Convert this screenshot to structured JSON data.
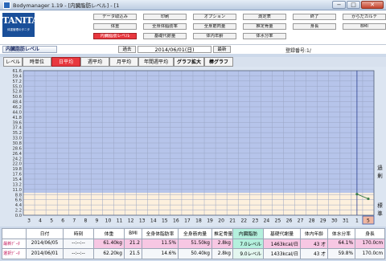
{
  "window": {
    "title": "Bodymanager 1.19 - [内臓脂肪レベル] - [1",
    "minimize": "−",
    "maximize": "□",
    "close": "✕"
  },
  "logo": {
    "text": "TANITA",
    "sub": "体重管理のタニタ"
  },
  "menu": {
    "row1": [
      "データ取込み",
      "印刷",
      "オプション",
      "測定表",
      "終了",
      "からだカルテ"
    ],
    "row2": [
      "体重",
      "全身体脂肪率",
      "全身筋肉量",
      "推定骨量",
      "身長",
      "BMI"
    ],
    "row3": [
      "内臓脂肪レベル",
      "基礎代謝量",
      "体内年齢",
      "体水分率"
    ],
    "active": "内臓脂肪レベル"
  },
  "section_title": "内臓脂肪レベル",
  "nav": {
    "prev": "過去",
    "date": "2014/06/01(日)",
    "next": "最新"
  },
  "registration": {
    "label": "登録番号:",
    "value": "1/"
  },
  "tabs": [
    "レベル",
    "時単位",
    "日平均",
    "週平均",
    "月平均",
    "年間週平均",
    "グラフ拡大",
    "棒グラフ"
  ],
  "active_tab": "日平均",
  "chart_data": {
    "type": "line",
    "ylim": [
      0,
      61.6
    ],
    "yticks": [
      "61.6",
      "59.4",
      "57.2",
      "55.0",
      "52.8",
      "50.6",
      "48.4",
      "46.2",
      "44.0",
      "41.8",
      "39.6",
      "37.4",
      "35.2",
      "33.0",
      "30.8",
      "28.6",
      "26.4",
      "24.2",
      "22.0",
      "19.8",
      "17.6",
      "15.4",
      "13.2",
      "11.0",
      "8.8",
      "6.6",
      "4.4",
      "2.2",
      "0.0"
    ],
    "x": [
      "3",
      "4",
      "5",
      "6",
      "7",
      "8",
      "9",
      "10",
      "11",
      "12",
      "13",
      "14",
      "15",
      "16",
      "17",
      "18",
      "19",
      "20",
      "21",
      "22",
      "23",
      "24",
      "25",
      "26",
      "27",
      "28",
      "29",
      "30",
      "31",
      "1",
      "5"
    ],
    "series": [
      {
        "values": [
          null,
          null,
          null,
          null,
          null,
          null,
          null,
          null,
          null,
          null,
          null,
          null,
          null,
          null,
          null,
          null,
          null,
          null,
          null,
          null,
          null,
          null,
          null,
          null,
          null,
          null,
          null,
          null,
          null,
          9.0,
          7.0
        ]
      }
    ],
    "zones": [
      {
        "label": "過剰",
        "from": 9.5,
        "to": 61.6,
        "color": "#b6c4ea"
      },
      {
        "label": "標準",
        "from": 0,
        "to": 9.5,
        "color": "#fdf0dd"
      }
    ]
  },
  "table": {
    "headers": [
      "日付",
      "時刻",
      "体重",
      "BMI",
      "全身体脂肪率",
      "全身筋肉量",
      "推定骨量",
      "内臓脂肪",
      "基礎代謝量",
      "体内年齢",
      "体水分率",
      "身長"
    ],
    "rows": [
      {
        "label": "最新ﾃﾞｰﾀ",
        "cells": [
          "2014/06/05",
          "--:--:--",
          "61.40kg",
          "21.2",
          "11.5%",
          "51.50kg",
          "2.8kg",
          "7.0レベル",
          "1463kcal/日",
          "43 才",
          "64.1%",
          "170.0cm"
        ]
      },
      {
        "label": "選択ﾃﾞｰﾀ",
        "cells": [
          "2014/06/01",
          "--:--:--",
          "62.20kg",
          "21.5",
          "14.6%",
          "50.40kg",
          "2.8kg",
          "9.0レベル",
          "1433kcal/日",
          "43 才",
          "59.8%",
          "170.0cm"
        ]
      }
    ]
  }
}
